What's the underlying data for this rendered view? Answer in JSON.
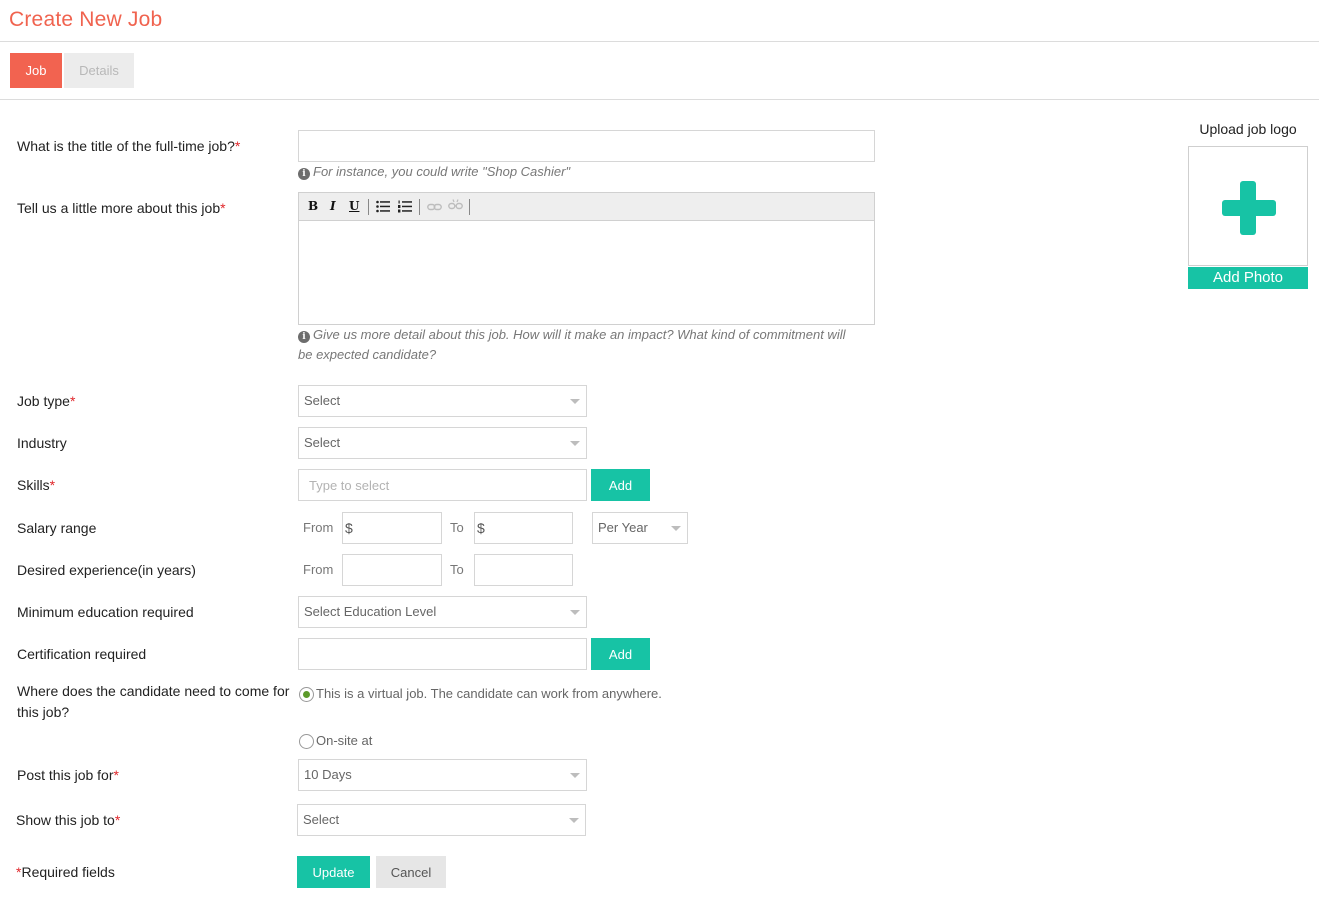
{
  "page": {
    "title": "Create New Job"
  },
  "tabs": {
    "job": "Job",
    "details": "Details"
  },
  "required_mark": "*",
  "fields": {
    "title": {
      "label": "What is the title of the full-time job?",
      "value": "",
      "hint": "For instance, you could write \"Shop Cashier\""
    },
    "description": {
      "label": "Tell us a little more about this job",
      "value": "",
      "hint_line1": "Give us more detail about this job. How will it make an impact? What kind of commitment will",
      "hint_line2": "be expected candidate?",
      "toolbar": {
        "bold": "B",
        "italic": "I",
        "underline": "U"
      }
    },
    "job_type": {
      "label": "Job type",
      "value": "Select"
    },
    "industry": {
      "label": "Industry",
      "value": "Select"
    },
    "skills": {
      "label": "Skills",
      "placeholder": "Type to select",
      "add_label": "Add"
    },
    "salary": {
      "label": "Salary range",
      "from_label": "From",
      "to_label": "To",
      "currency": "$",
      "from_value": "",
      "to_value": "",
      "period": "Per Year"
    },
    "experience": {
      "label": "Desired experience(in years)",
      "from_label": "From",
      "to_label": "To",
      "from_value": "",
      "to_value": ""
    },
    "education": {
      "label": "Minimum education required",
      "value": "Select Education Level"
    },
    "certification": {
      "label": "Certification required",
      "value": "",
      "add_label": "Add"
    },
    "location": {
      "label_line1": "Where does the candidate need to come for",
      "label_line2": "this job?",
      "option_virtual": "This is a virtual job. The candidate can work from anywhere.",
      "option_onsite": "On-site at",
      "selected": "virtual"
    },
    "post_duration": {
      "label": "Post this job for",
      "value": "10 Days"
    },
    "visibility": {
      "label": "Show this job to",
      "value": "Select"
    }
  },
  "footer": {
    "required_note": "Required fields",
    "update_label": "Update",
    "cancel_label": "Cancel"
  },
  "upload": {
    "title": "Upload job logo",
    "button_label": "Add Photo"
  },
  "colors": {
    "accent": "#f26350",
    "teal": "#17c3a5",
    "required": "#e0262a",
    "radio_checked": "#5c9a2a"
  }
}
